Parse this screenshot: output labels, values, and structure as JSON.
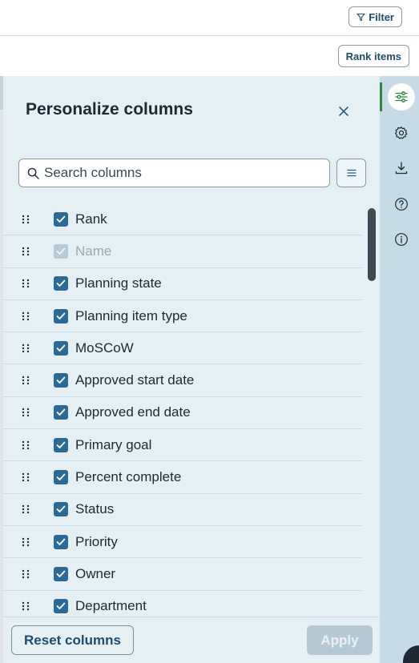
{
  "toolbar": {
    "filter_label": "Filter",
    "rank_items_label": "Rank items"
  },
  "panel": {
    "title": "Personalize columns",
    "search_placeholder": "Search columns",
    "columns": [
      {
        "label": "Rank",
        "checked": true,
        "disabled": false
      },
      {
        "label": "Name",
        "checked": true,
        "disabled": true
      },
      {
        "label": "Planning state",
        "checked": true,
        "disabled": false
      },
      {
        "label": "Planning item type",
        "checked": true,
        "disabled": false
      },
      {
        "label": "MoSCoW",
        "checked": true,
        "disabled": false
      },
      {
        "label": "Approved start date",
        "checked": true,
        "disabled": false
      },
      {
        "label": "Approved end date",
        "checked": true,
        "disabled": false
      },
      {
        "label": "Primary goal",
        "checked": true,
        "disabled": false
      },
      {
        "label": "Percent complete",
        "checked": true,
        "disabled": false
      },
      {
        "label": "Status",
        "checked": true,
        "disabled": false
      },
      {
        "label": "Priority",
        "checked": true,
        "disabled": false
      },
      {
        "label": "Owner",
        "checked": true,
        "disabled": false
      },
      {
        "label": "Department",
        "checked": true,
        "disabled": false
      }
    ],
    "reset_label": "Reset columns",
    "apply_label": "Apply"
  },
  "rail": {
    "items": [
      {
        "icon": "sliders-icon",
        "active": true
      },
      {
        "icon": "gear-icon",
        "active": false
      },
      {
        "icon": "download-icon",
        "active": false
      },
      {
        "icon": "help-icon",
        "active": false
      },
      {
        "icon": "info-icon",
        "active": false
      }
    ]
  },
  "colors": {
    "panel_bg": "#e5f0f5",
    "checkbox": "#2b6a96",
    "rail_bg": "#c6dbe5",
    "accent_active": "#2e8540"
  }
}
